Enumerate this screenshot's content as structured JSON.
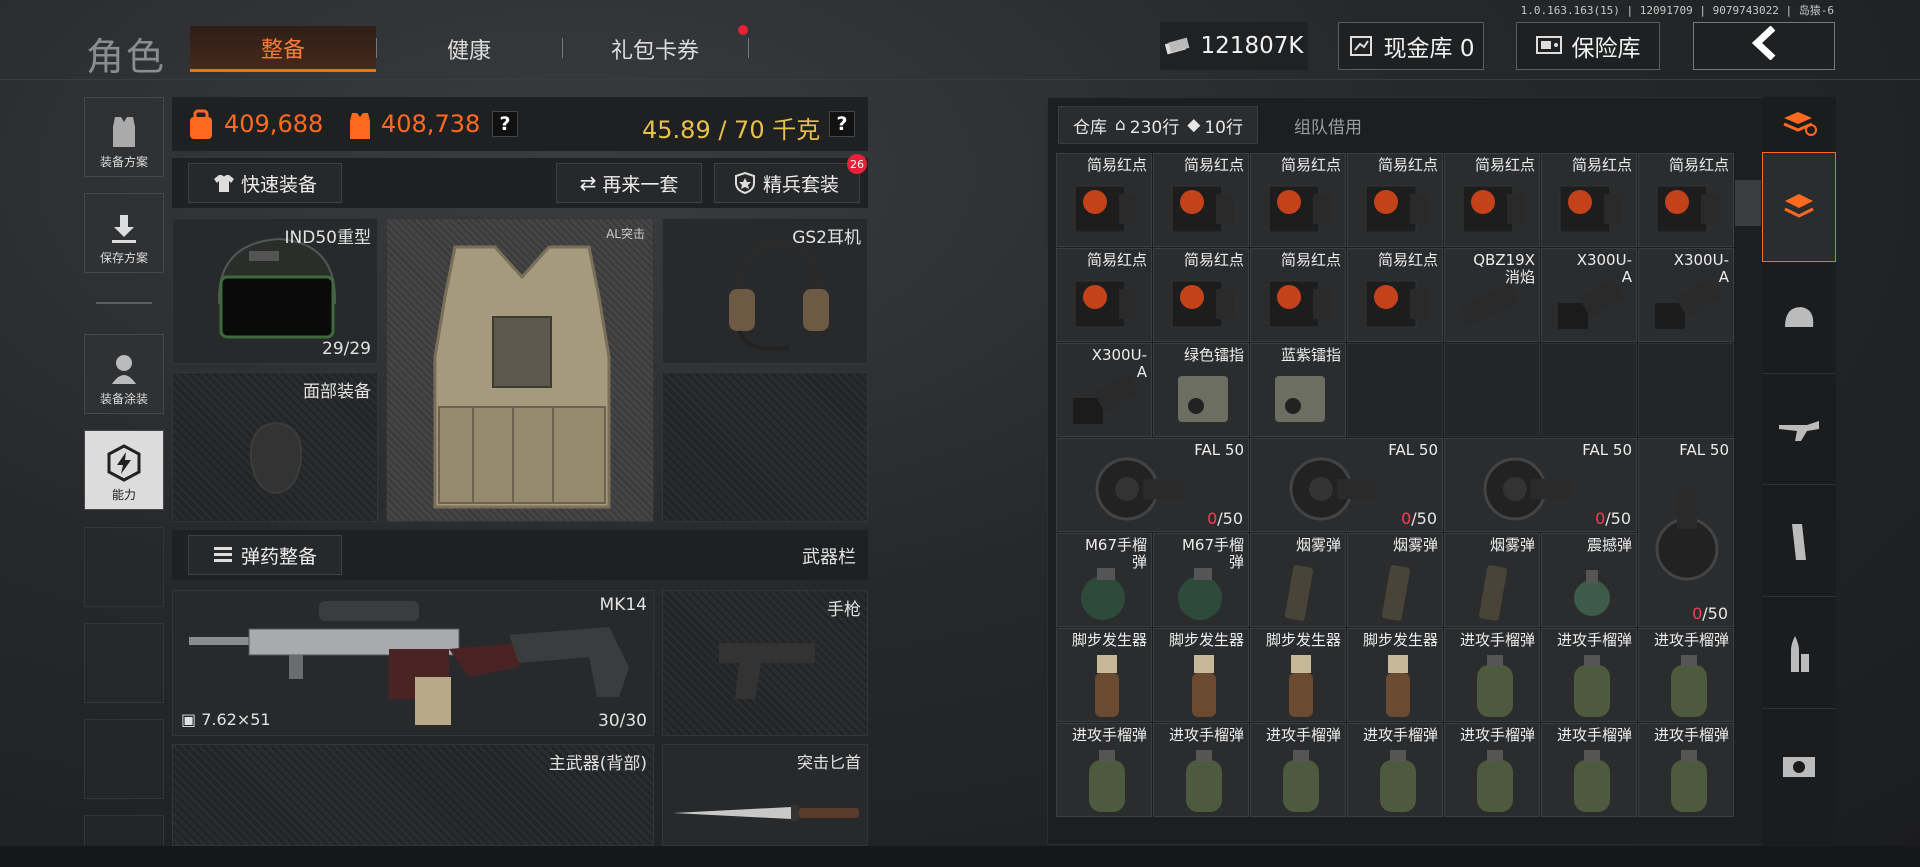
{
  "version_text": "1.0.163.163(15) | 12091709 | 9079743022 | 岛猿-6",
  "header": {
    "role_title": "角色",
    "tabs": [
      {
        "label": "整备"
      },
      {
        "label": "健康"
      },
      {
        "label": "礼包卡券"
      }
    ],
    "currency": "121807K",
    "cash_vault": "现金库 0",
    "safe": "保险库"
  },
  "leftnav": {
    "items": [
      {
        "label": "装备方案"
      },
      {
        "label": "保存方案"
      },
      {
        "label": "装备涂装"
      },
      {
        "label": "能力"
      }
    ]
  },
  "stats": {
    "value1": "409,688",
    "value2": "408,738",
    "weight": "45.89 / 70 千克",
    "help": "?"
  },
  "actions": {
    "quick_equip": "快速装备",
    "redo": "再来一套",
    "elite": "精兵套装",
    "elite_badge": "26"
  },
  "slots": {
    "helmet": {
      "name": "IND50重型",
      "count": "29/29"
    },
    "vest": {
      "name": "AL突击"
    },
    "headset": {
      "name": "GS2耳机"
    },
    "face": {
      "name": "面部装备"
    },
    "ammo_btn": "弹药整备",
    "weapon_bar": "武器栏",
    "primary": {
      "name": "MK14",
      "caliber": "7.62×51",
      "count": "30/30"
    },
    "pistol": {
      "name": "手枪"
    },
    "back": {
      "name": "主武器(背部)"
    },
    "knife": {
      "name": "突击匕首"
    }
  },
  "warehouse": {
    "tab_label": "仓库",
    "rows": "230行",
    "ticket": "10行",
    "team_borrow": "组队借用",
    "items": [
      {
        "name": "简易红点"
      },
      {
        "name": "简易红点"
      },
      {
        "name": "简易红点"
      },
      {
        "name": "简易红点"
      },
      {
        "name": "简易红点"
      },
      {
        "name": "简易红点"
      },
      {
        "name": "简易红点"
      },
      {
        "name": "简易红点"
      },
      {
        "name": "简易红点"
      },
      {
        "name": "简易红点"
      },
      {
        "name": "简易红点"
      },
      {
        "name": "QBZ19X\n消焰"
      },
      {
        "name": "X300U-\nA"
      },
      {
        "name": "X300U-\nA"
      },
      {
        "name": "X300U-\nA"
      },
      {
        "name": "绿色镭指"
      },
      {
        "name": "蓝紫镭指"
      }
    ],
    "mags": [
      {
        "name": "FAL 50",
        "count_zero": "0",
        "count_rest": "/50"
      },
      {
        "name": "FAL 50",
        "count_zero": "0",
        "count_rest": "/50"
      },
      {
        "name": "FAL 50",
        "count_zero": "0",
        "count_rest": "/50"
      },
      {
        "name": "FAL 50",
        "count_zero": "0",
        "count_rest": "/50"
      }
    ],
    "grenades": [
      {
        "name": "M67手榴\n弹"
      },
      {
        "name": "M67手榴\n弹"
      },
      {
        "name": "烟雾弹"
      },
      {
        "name": "烟雾弹"
      },
      {
        "name": "烟雾弹"
      },
      {
        "name": "震撼弹"
      }
    ],
    "row7": [
      {
        "name": "脚步发生器"
      },
      {
        "name": "脚步发生器"
      },
      {
        "name": "脚步发生器"
      },
      {
        "name": "脚步发生器"
      },
      {
        "name": "进攻手榴弹"
      },
      {
        "name": "进攻手榴弹"
      },
      {
        "name": "进攻手榴弹"
      }
    ],
    "row8": [
      {
        "name": "进攻手榴弹"
      },
      {
        "name": "进攻手榴弹"
      },
      {
        "name": "进攻手榴弹"
      },
      {
        "name": "进攻手榴弹"
      },
      {
        "name": "进攻手榴弹"
      },
      {
        "name": "进攻手榴弹"
      },
      {
        "name": "进攻手榴弹"
      }
    ]
  },
  "colors": {
    "accent": "#ff6a20",
    "zero": "#ff3a5a"
  }
}
